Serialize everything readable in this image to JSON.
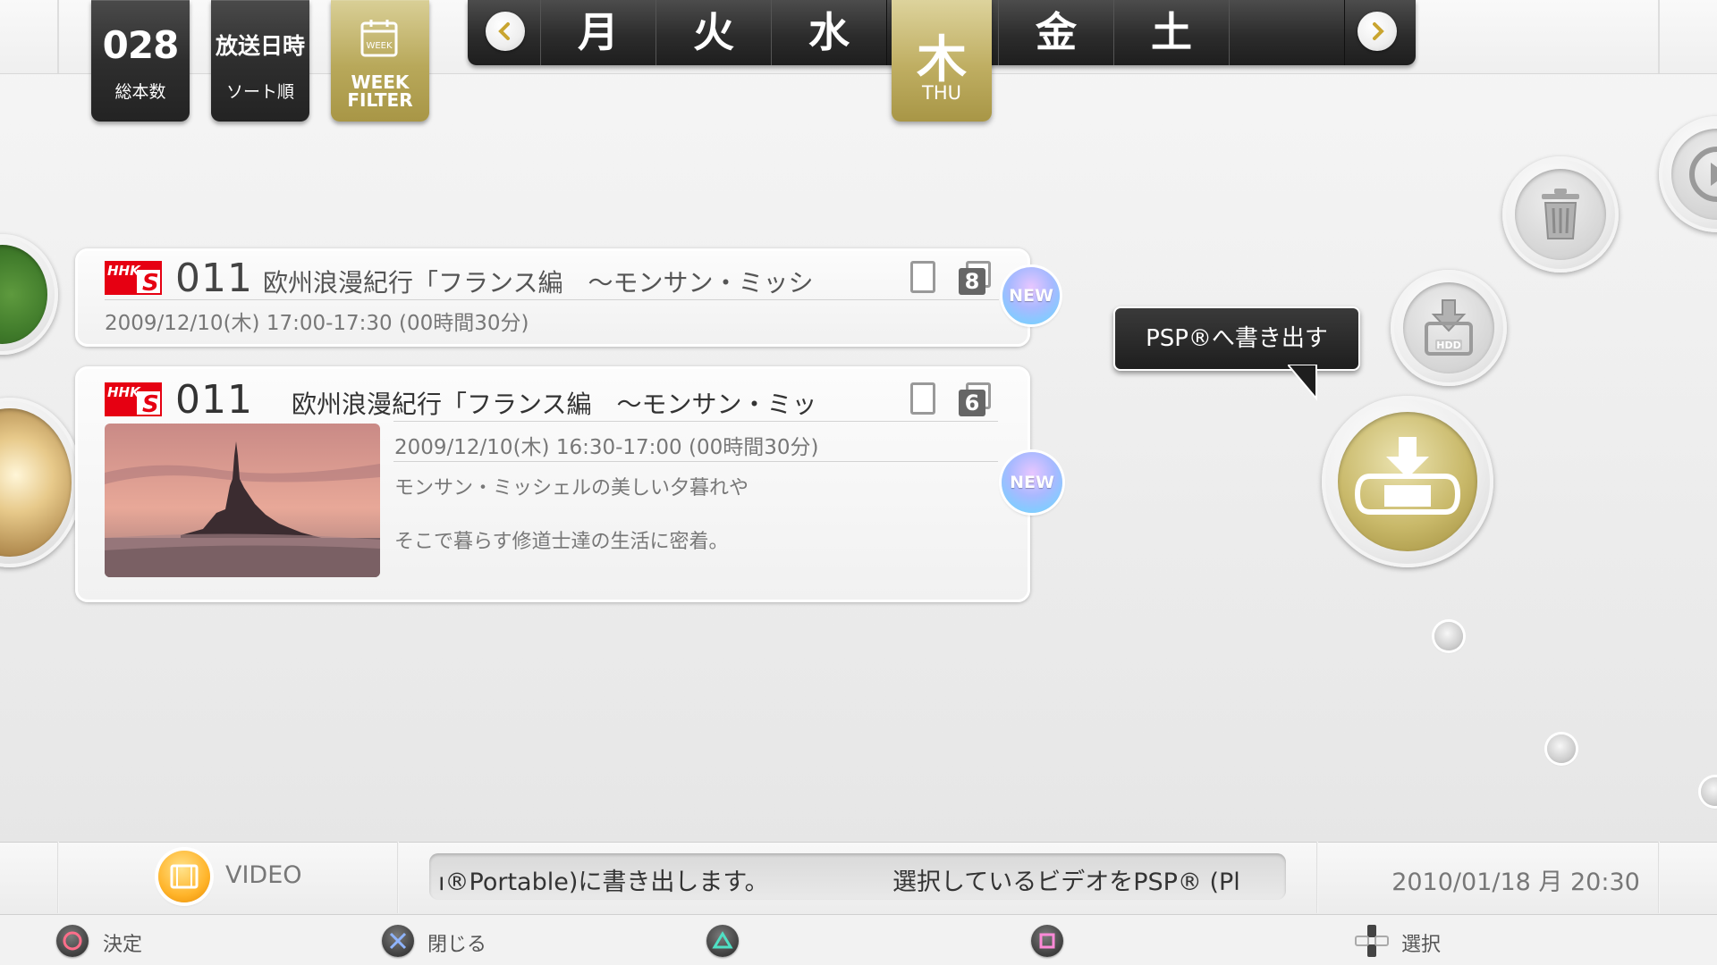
{
  "header": {
    "count_value": "028",
    "count_label": "総本数",
    "sort_value": "放送日時",
    "sort_label": "ソート順",
    "calendar_week": "WEEK",
    "week_filter_line1": "WEEK",
    "week_filter_line2": "FILTER"
  },
  "days": {
    "mon": "月",
    "tue": "火",
    "wed": "水",
    "thu": "木",
    "thu_en": "THU",
    "fri": "金",
    "sat": "土"
  },
  "recordings": [
    {
      "channel_logo": "HHK S",
      "channel_number": "011",
      "title": "欧州浪漫紀行「フランス編　～モンサン・ミッシ",
      "datetime": "2009/12/10(木) 17:00-17:30 (00時間30分)",
      "chapters": "8",
      "badge": "NEW"
    },
    {
      "channel_logo": "HHK S",
      "channel_number": "011",
      "title": "欧州浪漫紀行「フランス編　～モンサン・ミッ",
      "datetime": "2009/12/10(木) 16:30-17:00 (00時間30分)",
      "description_line1": "モンサン・ミッシェルの美しい夕暮れや",
      "description_line2": "そこで暮らす修道士達の生活に密着。",
      "chapters": "6",
      "badge": "NEW"
    }
  ],
  "side_menu": {
    "hdd_label": "HDD",
    "tooltip": "PSP®へ書き出す"
  },
  "status_bar": {
    "app_label": "VIDEO",
    "ticker_part1": "ı®Portable)に書き出します。",
    "ticker_part2": "選択しているビデオをPSP® (Pl",
    "datetime": "2010/01/18 月 20:30"
  },
  "hints": {
    "circle": "決定",
    "cross": "閉じる",
    "dpad": "選択"
  },
  "colors": {
    "accent_gold": "#bfae62",
    "dark_tile": "#2e2e2e",
    "new_badge": "#8fc8ff"
  }
}
